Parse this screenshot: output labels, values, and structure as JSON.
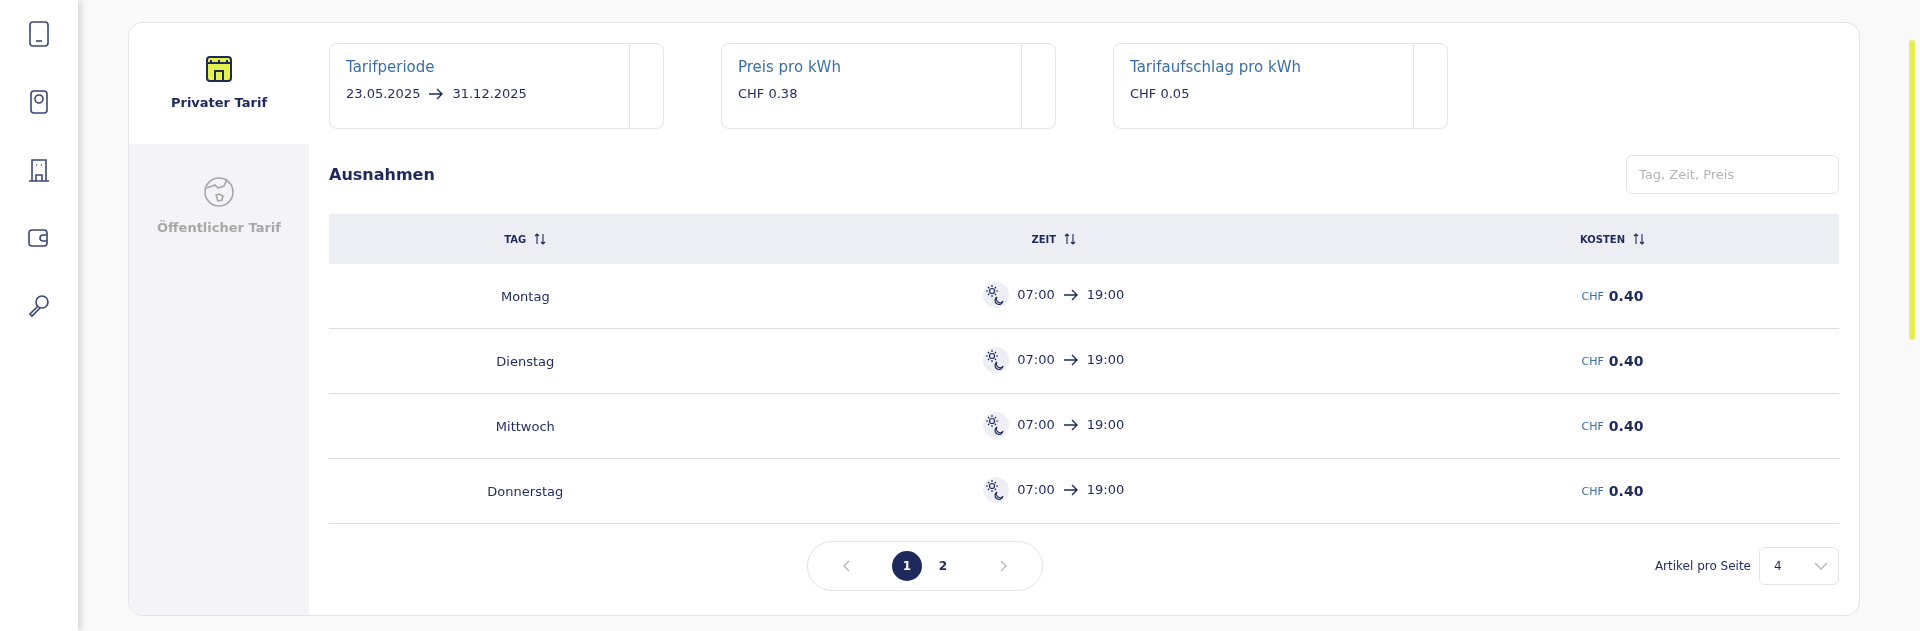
{
  "tariff_tabs": [
    {
      "label": "Privater Tarif",
      "selected": true
    },
    {
      "label": "Öffentlicher Tarif",
      "selected": false
    }
  ],
  "info_cards": [
    {
      "title": "Tarifperiode",
      "kind": "range",
      "from": "23.05.2025",
      "to": "31.12.2025"
    },
    {
      "title": "Preis pro kWh",
      "kind": "value",
      "value": "CHF 0.38"
    },
    {
      "title": "Tarifaufschlag pro kWh",
      "kind": "value",
      "value": "CHF 0.05"
    }
  ],
  "exceptions": {
    "title": "Ausnahmen",
    "search": {
      "placeholder": "Tag, Zeit, Preis"
    },
    "columns": [
      "TAG",
      "ZEIT",
      "KOSTEN"
    ],
    "rows": [
      {
        "day": "Montag",
        "from": "07:00",
        "to": "19:00",
        "currency": "CHF",
        "amount": "0.40"
      },
      {
        "day": "Dienstag",
        "from": "07:00",
        "to": "19:00",
        "currency": "CHF",
        "amount": "0.40"
      },
      {
        "day": "Mittwoch",
        "from": "07:00",
        "to": "19:00",
        "currency": "CHF",
        "amount": "0.40"
      },
      {
        "day": "Donnerstag",
        "from": "07:00",
        "to": "19:00",
        "currency": "CHF",
        "amount": "0.40"
      }
    ]
  },
  "pagination": {
    "pages": [
      {
        "label": "1",
        "selected": true
      },
      {
        "label": "2",
        "selected": false
      }
    ],
    "per_page_label": "Artikel pro Seite",
    "per_page": "4"
  }
}
